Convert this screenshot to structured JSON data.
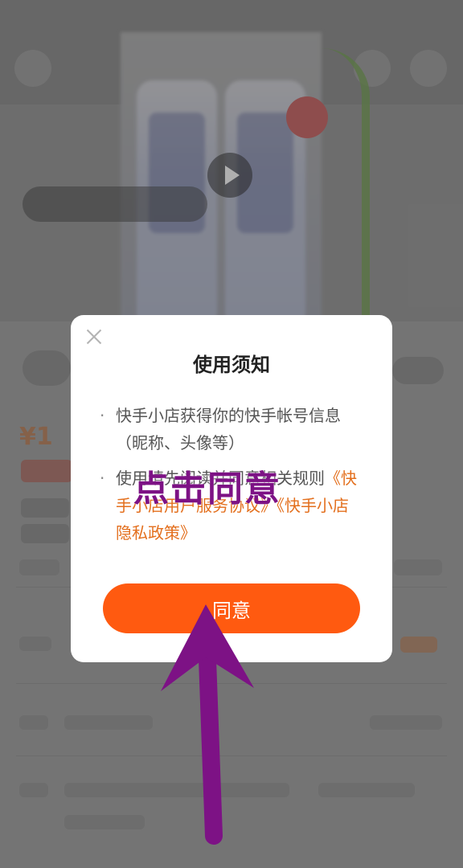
{
  "background": {
    "status_bar": {
      "time": "",
      "right": ""
    }
  },
  "dialog": {
    "title": "使用须知",
    "bullets": [
      {
        "text": "快手小店获得你的快手帐号信息（昵称、头像等）"
      },
      {
        "prefix": "使用",
        "hidden_text": "请先阅读并同意",
        "mid": "相关规则",
        "link1": "《快手小店用户服务协议》",
        "link2": "《快手小店隐私政策》"
      }
    ],
    "agree_label": "同意"
  },
  "annotation": {
    "label": "点击同意",
    "color": "#7d1285"
  },
  "colors": {
    "accent": "#ff5a10",
    "link": "#e36f1d"
  }
}
